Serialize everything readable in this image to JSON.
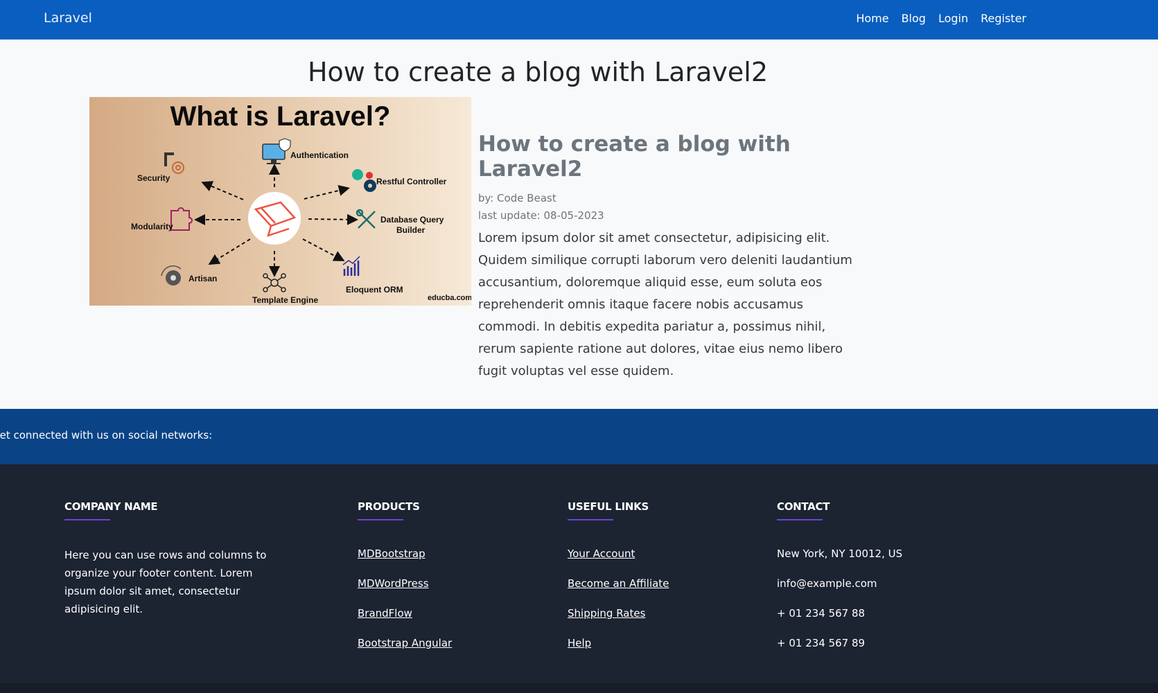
{
  "nav": {
    "brand": "Laravel",
    "links": [
      "Home",
      "Blog",
      "Login",
      "Register"
    ]
  },
  "page": {
    "title": "How to create a blog with Laravel2"
  },
  "hero_image": {
    "heading": "What is Laravel?",
    "labels": {
      "authentication": "Authentication",
      "security": "Security",
      "restful": "Restful Controller",
      "modularity": "Modularity",
      "db_query": "Database Query",
      "db_builder": "Builder",
      "artisan": "Artisan",
      "eloquent": "Eloquent ORM",
      "template": "Template Engine",
      "credit": "educba.com"
    }
  },
  "post": {
    "title": "How to create a blog with Laravel2",
    "author": "by: Code Beast",
    "updated": "last update: 08-05-2023",
    "body": "Lorem ipsum dolor sit amet consectetur, adipisicing elit. Quidem similique corrupti laborum vero deleniti laudantium accusantium, doloremque aliquid esse, eum soluta eos reprehenderit omnis itaque facere nobis accusamus commodi. In debitis expedita pariatur a, possimus nihil, rerum sapiente ratione aut dolores, vitae eius nemo libero fugit voluptas vel esse quidem."
  },
  "social": {
    "text": "Get connected with us on social networks:"
  },
  "footer": {
    "company": {
      "heading": "Company name",
      "text": "Here you can use rows and columns to organize your footer content. Lorem ipsum dolor sit amet, consectetur adipisicing elit."
    },
    "products": {
      "heading": "Products",
      "links": [
        "MDBootstrap",
        "MDWordPress",
        "BrandFlow",
        "Bootstrap Angular"
      ]
    },
    "useful": {
      "heading": "Useful links",
      "links": [
        "Your Account",
        "Become an Affiliate",
        "Shipping Rates",
        "Help"
      ]
    },
    "contact": {
      "heading": "Contact",
      "items": [
        "New York, NY 10012, US",
        "info@example.com",
        "+ 01 234 567 88",
        "+ 01 234 567 89"
      ]
    }
  },
  "colors": {
    "navbar": "#095ebf",
    "social_bar": "#0a4486",
    "footer": "#1c2331",
    "accent_rule": "#7c4dff"
  }
}
